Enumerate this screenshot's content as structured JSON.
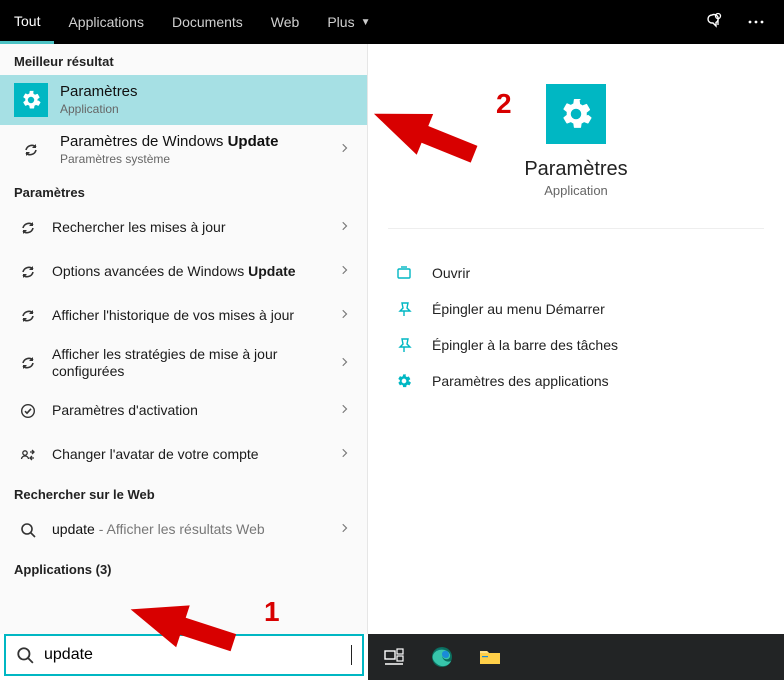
{
  "tabs": {
    "items": [
      "Tout",
      "Applications",
      "Documents",
      "Web",
      "Plus"
    ],
    "active": 0
  },
  "sections": {
    "best": "Meilleur résultat",
    "settings": "Paramètres",
    "web": "Rechercher sur le Web",
    "apps": "Applications (3)"
  },
  "best_result": {
    "title": "Paramètres",
    "subtitle": "Application"
  },
  "second_result": {
    "title_pre": "Paramètres de Windows ",
    "title_bold": "Update",
    "subtitle": "Paramètres système"
  },
  "settings_items": [
    "Rechercher les mises à jour",
    "Options avancées de Windows Update",
    "Afficher l'historique de vos mises à jour",
    "Afficher les stratégies de mise à jour configurées",
    "Paramètres d'activation",
    "Changer l'avatar de votre compte"
  ],
  "web_result": {
    "prefix": "update",
    "suffix": " - Afficher les résultats Web"
  },
  "hero": {
    "title": "Paramètres",
    "subtitle": "Application"
  },
  "actions": [
    "Ouvrir",
    "Épingler au menu Démarrer",
    "Épingler à la barre des tâches",
    "Paramètres des applications"
  ],
  "search": {
    "value": "update"
  },
  "annotations": {
    "n1": "1",
    "n2": "2"
  },
  "colors": {
    "accent": "#00b7c3",
    "arrow": "#d80000"
  }
}
